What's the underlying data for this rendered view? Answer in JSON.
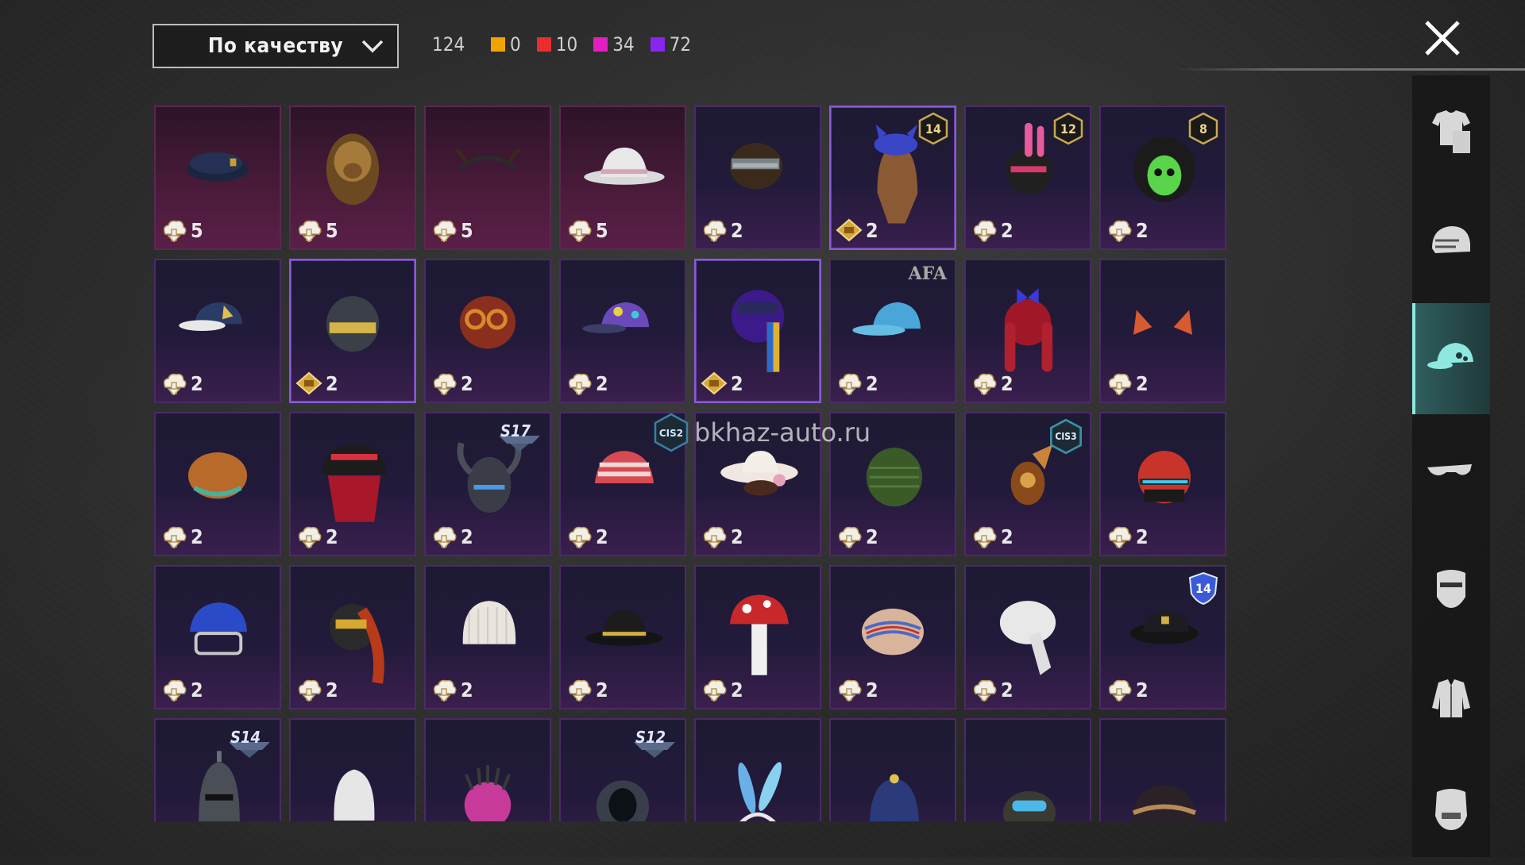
{
  "sort": {
    "label": "По качеству"
  },
  "counts": {
    "total": "124",
    "rarities": [
      {
        "color": "#f0a400",
        "count": "0"
      },
      {
        "color": "#ea2d2d",
        "count": "10"
      },
      {
        "color": "#e21ec0",
        "count": "34"
      },
      {
        "color": "#8a25f0",
        "count": "72"
      }
    ]
  },
  "watermark": {
    "badge": "CIS2",
    "text": "bkhaz-auto.ru"
  },
  "categories": [
    {
      "name": "outfit-icon"
    },
    {
      "name": "helmet-icon"
    },
    {
      "name": "cap-icon",
      "active": true
    },
    {
      "name": "glasses-icon"
    },
    {
      "name": "mask-icon"
    },
    {
      "name": "jacket-icon"
    },
    {
      "name": "face-icon"
    }
  ],
  "items": [
    {
      "name": "navy beret",
      "cost": "5",
      "currency": "cloud",
      "theme": "pink",
      "art": "beret"
    },
    {
      "name": "lion mask",
      "cost": "5",
      "currency": "cloud",
      "theme": "pink",
      "art": "lion"
    },
    {
      "name": "headband horns",
      "cost": "5",
      "currency": "cloud",
      "theme": "pink",
      "art": "band"
    },
    {
      "name": "white fedora",
      "cost": "5",
      "currency": "cloud",
      "theme": "pink",
      "art": "fedora"
    },
    {
      "name": "goggles dreads",
      "cost": "2",
      "currency": "cloud",
      "art": "dreads"
    },
    {
      "name": "cat cap hair",
      "cost": "2",
      "currency": "gold",
      "badge": "14",
      "badgeStyle": "hex",
      "selected": true,
      "art": "cathair"
    },
    {
      "name": "bunny helmet",
      "cost": "2",
      "currency": "cloud",
      "badge": "12",
      "badgeStyle": "hex",
      "art": "bunnyhelm"
    },
    {
      "name": "green skull hood",
      "cost": "2",
      "currency": "cloud",
      "badge": "8",
      "badgeStyle": "hex",
      "art": "skullhood"
    },
    {
      "name": "white cap",
      "cost": "2",
      "currency": "cloud",
      "art": "cap"
    },
    {
      "name": "gold visor helmet",
      "cost": "2",
      "currency": "gold",
      "selected": true,
      "art": "goldhelm"
    },
    {
      "name": "goggles red hair",
      "cost": "2",
      "currency": "cloud",
      "art": "redhair"
    },
    {
      "name": "rainbow cap",
      "cost": "2",
      "currency": "cloud",
      "art": "rainbowcap"
    },
    {
      "name": "purple hood",
      "cost": "2",
      "currency": "gold",
      "selected": true,
      "art": "purplehood"
    },
    {
      "name": "blue cap",
      "cost": "2",
      "currency": "cloud",
      "badge": "AFA",
      "badgeStyle": "text",
      "art": "bluecap"
    },
    {
      "name": "red pigtails",
      "cost": "2",
      "currency": "cloud",
      "art": "pigtails"
    },
    {
      "name": "cat ears",
      "cost": "2",
      "currency": "cloud",
      "art": "catears"
    },
    {
      "name": "orange hat",
      "cost": "2",
      "currency": "cloud",
      "art": "orangehat"
    },
    {
      "name": "bucket red hair",
      "cost": "2",
      "currency": "cloud",
      "art": "bucket"
    },
    {
      "name": "horned helmet",
      "cost": "2",
      "currency": "cloud",
      "badge": "S17",
      "badgeStyle": "season",
      "art": "horned"
    },
    {
      "name": "striped beanie",
      "cost": "2",
      "currency": "cloud",
      "art": "striped"
    },
    {
      "name": "flower hat",
      "cost": "2",
      "currency": "cloud",
      "art": "flowerhat"
    },
    {
      "name": "green hood",
      "cost": "2",
      "currency": "cloud",
      "art": "greenhood"
    },
    {
      "name": "diving helmet",
      "cost": "2",
      "currency": "cloud",
      "badge": "CIS3",
      "badgeStyle": "hexwide",
      "art": "diving"
    },
    {
      "name": "football helmet",
      "cost": "2",
      "currency": "cloud",
      "art": "football"
    },
    {
      "name": "cricket helmet",
      "cost": "2",
      "currency": "cloud",
      "art": "cricket"
    },
    {
      "name": "cyber hair",
      "cost": "2",
      "currency": "cloud",
      "art": "cyberhair"
    },
    {
      "name": "white beanie",
      "cost": "2",
      "currency": "cloud",
      "art": "beanie"
    },
    {
      "name": "black hat",
      "cost": "2",
      "currency": "cloud",
      "art": "blackhat"
    },
    {
      "name": "mushroom hat",
      "cost": "2",
      "currency": "cloud",
      "art": "mushroom"
    },
    {
      "name": "swirl turban",
      "cost": "2",
      "currency": "cloud",
      "art": "turban"
    },
    {
      "name": "white turban",
      "cost": "2",
      "currency": "cloud",
      "art": "wturban"
    },
    {
      "name": "police cap",
      "cost": "2",
      "currency": "cloud",
      "badge": "14",
      "badgeStyle": "shield",
      "art": "police"
    },
    {
      "name": "knight helmet",
      "badge": "S14",
      "badgeStyle": "season",
      "art": "knight"
    },
    {
      "name": "white cloth",
      "art": "cloth"
    },
    {
      "name": "spiked helmet",
      "art": "spiked"
    },
    {
      "name": "pilot helmet",
      "badge": "S12",
      "badgeStyle": "season",
      "art": "pilot"
    },
    {
      "name": "bunny ears band",
      "art": "bunnyband"
    },
    {
      "name": "blue beanie",
      "art": "bluebeanie"
    },
    {
      "name": "camo helmet",
      "art": "camo"
    },
    {
      "name": "dark beanie",
      "art": "darkbeanie"
    }
  ]
}
